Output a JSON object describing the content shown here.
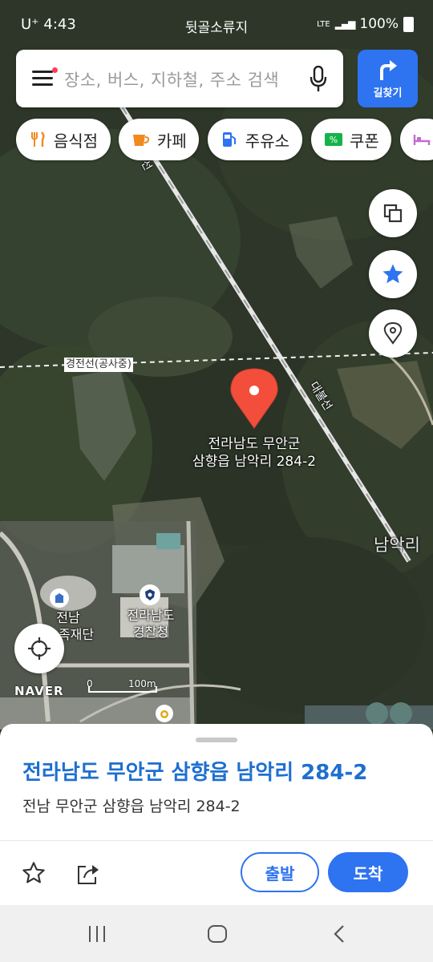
{
  "status_bar": {
    "carrier": "U⁺ 4:43",
    "center_label": "뒷골소류지",
    "network": "LTE",
    "battery": "100%"
  },
  "search": {
    "placeholder": "장소, 버스, 지하철, 주소 검색",
    "directions_label": "길찾기"
  },
  "chips": [
    {
      "label": "음식점",
      "icon": "fork-knife-icon"
    },
    {
      "label": "카페",
      "icon": "coffee-cup-icon"
    },
    {
      "label": "주유소",
      "icon": "gas-pump-icon"
    },
    {
      "label": "쿠폰",
      "icon": "coupon-icon"
    },
    {
      "label": "",
      "icon": "bed-icon"
    }
  ],
  "map": {
    "labels": {
      "rail_top": "선",
      "power_line": "경전선(공사중)",
      "rail_right": "대불선",
      "namak": "남악리",
      "jeonnam_a": "전남",
      "jeonnam_b": "족재단",
      "police_a": "전라남도",
      "police_b": "경찰청",
      "pin_line1": "전라남도 무안군",
      "pin_line2": "삼향읍 남악리 284-2"
    },
    "logo": "NAVER",
    "scale_zero": "0",
    "scale_label": "100m",
    "pin_color": "#f24e3b",
    "accent": "#2e73f0"
  },
  "sheet": {
    "title": "전라남도 무안군 삼향읍 남악리 284-2",
    "subtitle": "전남 무안군 삼향읍 남악리 284-2",
    "start_label": "출발",
    "arrive_label": "도착"
  }
}
